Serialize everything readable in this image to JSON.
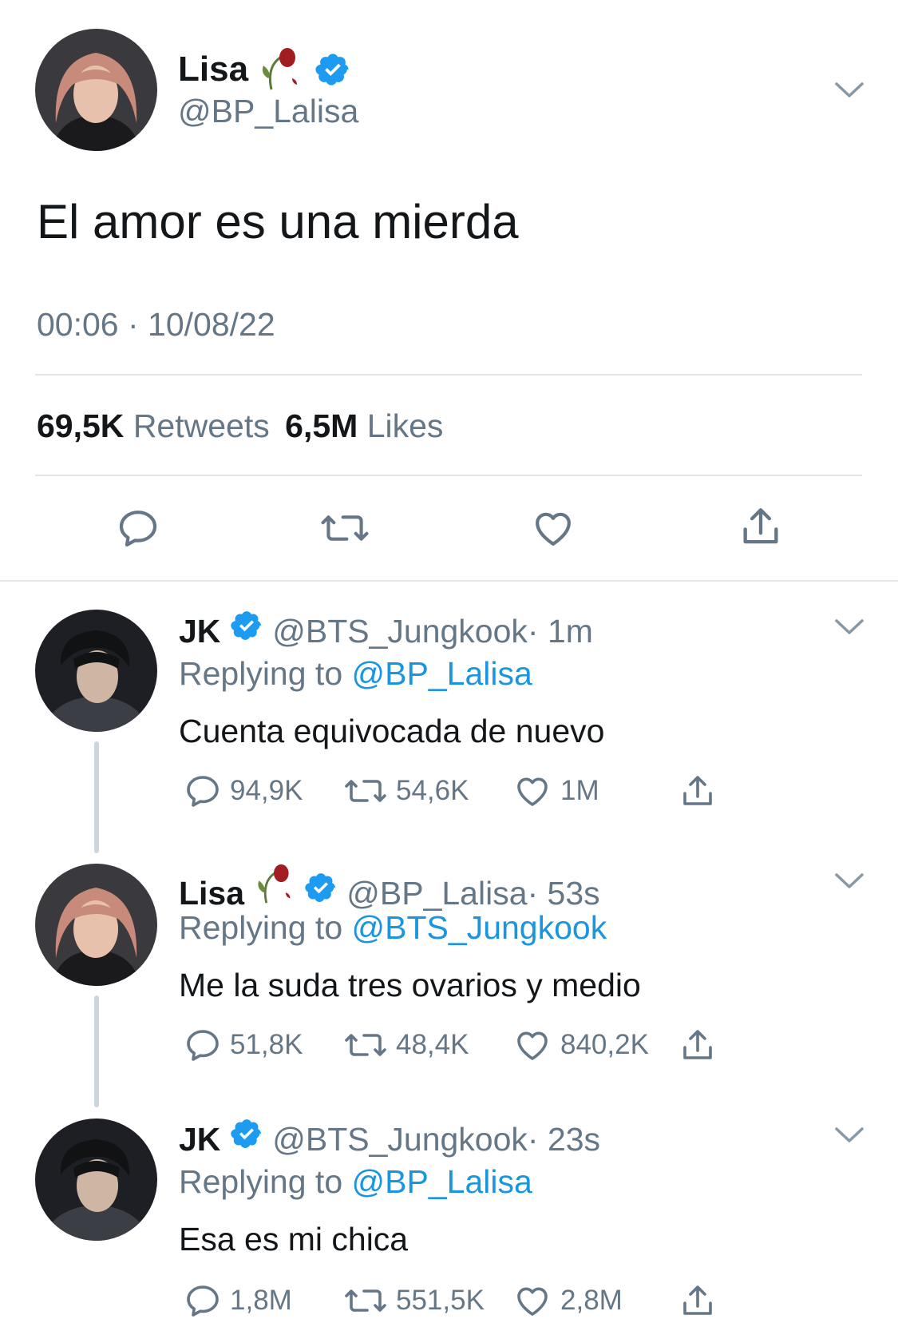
{
  "main_tweet": {
    "author_name": "Lisa",
    "author_emoji": "wilted-rose-emoji",
    "handle": "@BP_Lalisa",
    "text": "El amor es una mierda",
    "timestamp": "00:06 · 10/08/22",
    "retweets_count": "69,5K",
    "retweets_label": "Retweets",
    "likes_count": "6,5M",
    "likes_label": "Likes"
  },
  "replies": [
    {
      "author_name": "JK",
      "handle": "@BTS_Jungkook",
      "time": "· 1m",
      "replying_prefix": "Replying to",
      "replying_to": "@BP_Lalisa",
      "text": "Cuenta equivocada de nuevo",
      "replies_count": "94,9K",
      "retweets_count": "54,6K",
      "likes_count": "1M"
    },
    {
      "author_name": "Lisa",
      "handle": "@BP_Lalisa",
      "time": "· 53s",
      "replying_prefix": "Replying to",
      "replying_to": "@BTS_Jungkook",
      "text": "Me la suda tres ovarios y medio",
      "replies_count": "51,8K",
      "retweets_count": "48,4K",
      "likes_count": "840,2K"
    },
    {
      "author_name": "JK",
      "handle": "@BTS_Jungkook",
      "time": "· 23s",
      "replying_prefix": "Replying to",
      "replying_to": "@BP_Lalisa",
      "text": "Esa es mi chica",
      "replies_count": "1,8M",
      "retweets_count": "551,5K",
      "likes_count": "2,8M"
    }
  ],
  "colors": {
    "accent": "#1b95e0",
    "verified": "#1d9bf0",
    "secondary_text": "#657786",
    "divider": "#e1e8ed"
  }
}
